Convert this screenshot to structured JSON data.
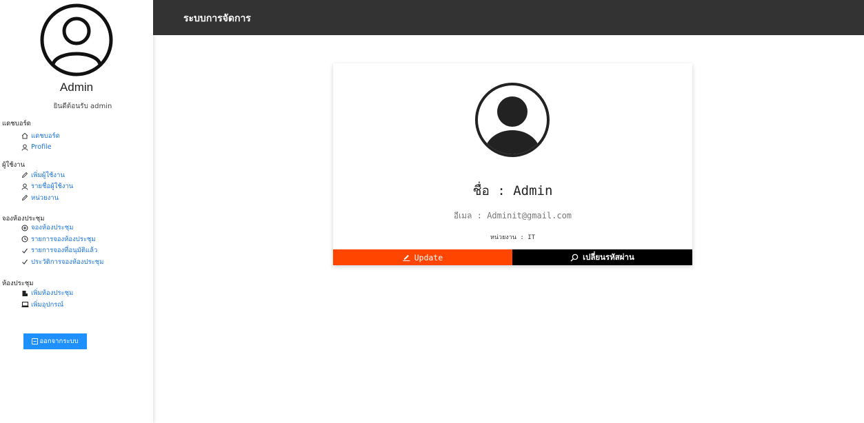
{
  "app": {
    "title": "ระบบการจัดการ"
  },
  "sidebar": {
    "user_name": "Admin",
    "welcome": "ยินดีต้อนรับ admin",
    "sections": [
      {
        "title": "แดชบอร์ด",
        "items": [
          {
            "label": "แดชบอร์ด",
            "icon": "home-icon"
          },
          {
            "label": "Profile",
            "icon": "user-icon"
          }
        ]
      },
      {
        "title": "ผู้ใช้งาน",
        "items": [
          {
            "label": "เพิ่มผู้ใช้งาน",
            "icon": "pencil-icon"
          },
          {
            "label": "รายชื่อผู้ใช้งาน",
            "icon": "user-icon"
          },
          {
            "label": "หน่วยงาน",
            "icon": "pencil-icon"
          }
        ]
      },
      {
        "title": "จองห้องประชุม",
        "items": [
          {
            "label": "จองห้องประชุม",
            "icon": "plus-circle-icon"
          },
          {
            "label": "รายการจองห้องประชุม",
            "icon": "clock-icon"
          },
          {
            "label": "รายการจองที่อนุมัติแล้ว",
            "icon": "check-icon"
          },
          {
            "label": "ประวัติการจองห้องประชุม",
            "icon": "check-icon"
          }
        ]
      },
      {
        "title": "ห้องประชุม",
        "items": [
          {
            "label": "เพิ่มห้องประชุม",
            "icon": "room-icon"
          },
          {
            "label": "เพิ่มอุปกรณ์",
            "icon": "laptop-icon"
          }
        ]
      }
    ],
    "logout_label": "ออกจากระบบ",
    "accent_color": "#1e90ff"
  },
  "profile": {
    "name_line": "ชื่อ : Admin",
    "email_line": "อีเมล : Adminit@gmail.com",
    "dept_line": "หน่วยงาน : IT",
    "update_label": "Update",
    "change_password_label": "เปลี่ยนรหัสผ่าน",
    "update_color": "#ff4500",
    "change_password_color": "#000000"
  }
}
